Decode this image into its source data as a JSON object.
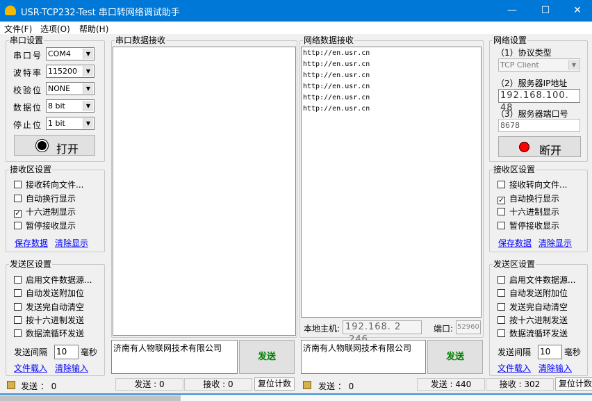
{
  "window": {
    "title": "USR-TCP232-Test 串口转网络调试助手",
    "min": "—",
    "max": "☐",
    "close": "✕"
  },
  "menu": [
    "文件(F)",
    "选项(O)",
    "帮助(H)"
  ],
  "serial": {
    "title": "串口设置",
    "fields": [
      {
        "label": "串口号",
        "value": "COM4"
      },
      {
        "label": "波特率",
        "value": "115200"
      },
      {
        "label": "校验位",
        "value": "NONE"
      },
      {
        "label": "数据位",
        "value": "8 bit"
      },
      {
        "label": "停止位",
        "value": "1 bit"
      }
    ],
    "open_label": "打开"
  },
  "left_recv": {
    "title": "接收区设置",
    "options": [
      {
        "label": "接收转向文件...",
        "checked": false
      },
      {
        "label": "自动换行显示",
        "checked": false
      },
      {
        "label": "十六进制显示",
        "checked": true
      },
      {
        "label": "暂停接收显示",
        "checked": false
      }
    ],
    "save": "保存数据",
    "clear": "清除显示"
  },
  "left_send": {
    "title": "发送区设置",
    "options": [
      {
        "label": "启用文件数据源...",
        "checked": false
      },
      {
        "label": "自动发送附加位",
        "checked": false
      },
      {
        "label": "发送完自动清空",
        "checked": false
      },
      {
        "label": "按十六进制发送",
        "checked": false
      },
      {
        "label": "数据流循环发送",
        "checked": false
      }
    ],
    "interval_label": "发送间隔",
    "interval": "10",
    "unit": "毫秒",
    "load": "文件载入",
    "clear": "清除输入"
  },
  "serial_rx": {
    "title": "串口数据接收"
  },
  "net_rx": {
    "title": "网络数据接收",
    "lines": [
      "http://en.usr.cn",
      "http://en.usr.cn",
      "http://en.usr.cn",
      "http://en.usr.cn",
      "http://en.usr.cn",
      "http://en.usr.cn"
    ]
  },
  "local": {
    "label": "本地主机:",
    "ip": "192.168. 2 .246",
    "port_label": "端口:",
    "port": "52960"
  },
  "serial_send": {
    "text": "济南有人物联网技术有限公司",
    "button": "发送"
  },
  "net_send": {
    "text": "济南有人物联网技术有限公司",
    "button": "发送"
  },
  "net": {
    "title": "网络设置",
    "proto_label": "（1）协议类型",
    "proto": "TCP Client",
    "ip_label": "（2）服务器IP地址",
    "ip": "192.168.100. 48",
    "port_label": "（3）服务器端口号",
    "port": "8678",
    "disconnect": "断开"
  },
  "right_recv": {
    "title": "接收区设置",
    "options": [
      {
        "label": "接收转向文件...",
        "checked": false
      },
      {
        "label": "自动换行显示",
        "checked": true
      },
      {
        "label": "十六进制显示",
        "checked": false
      },
      {
        "label": "暂停接收显示",
        "checked": false
      }
    ],
    "save": "保存数据",
    "clear": "清除显示"
  },
  "right_send": {
    "title": "发送区设置",
    "options": [
      {
        "label": "启用文件数据源...",
        "checked": false
      },
      {
        "label": "自动发送附加位",
        "checked": false
      },
      {
        "label": "发送完自动清空",
        "checked": false
      },
      {
        "label": "按十六进制发送",
        "checked": false
      },
      {
        "label": "数据流循环发送",
        "checked": false
      }
    ],
    "interval_label": "发送间隔",
    "interval": "10",
    "unit": "毫秒",
    "load": "文件载入",
    "clear": "清除输入"
  },
  "status": {
    "left_send": "发送 ： 0",
    "left_tx": "发送 : 0",
    "left_rx": "接收 : 0",
    "reset": "复位计数",
    "right_send": "发送 ： 0",
    "right_tx": "发送 : 440",
    "right_rx": "接收 : 302",
    "reset2": "复位计数"
  }
}
